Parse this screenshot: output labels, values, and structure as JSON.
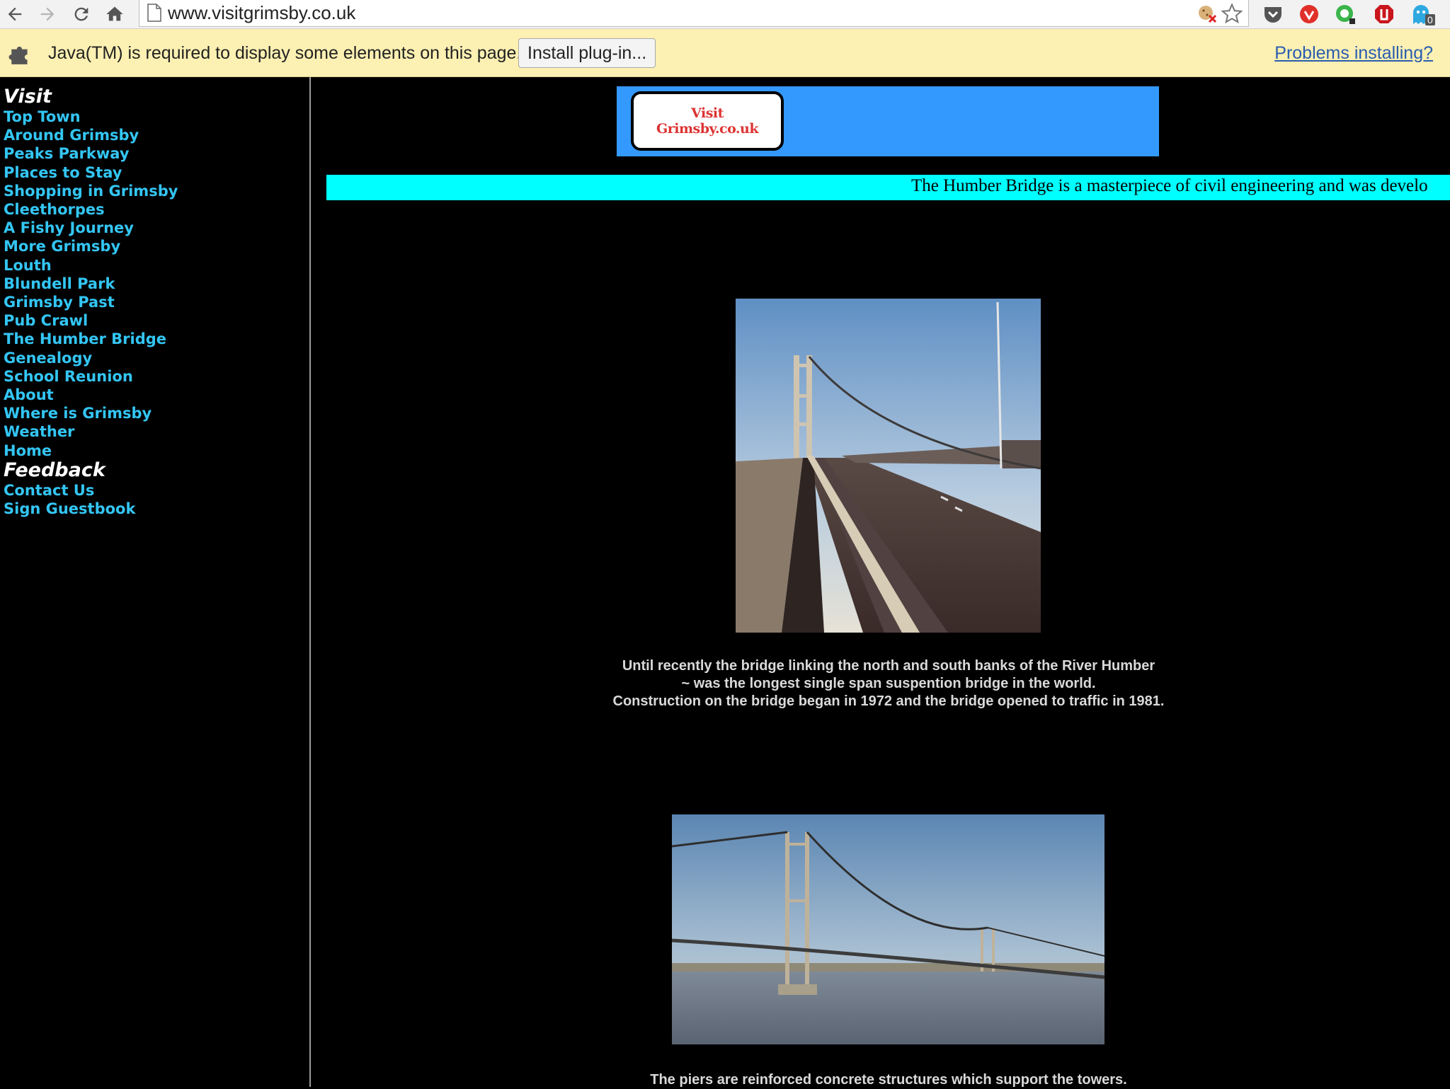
{
  "browser": {
    "url": "www.visitgrimsby.co.uk"
  },
  "infobar": {
    "message": "Java(TM) is required to display some elements on this page.",
    "install_button": "Install plug-in...",
    "problems_link": "Problems installing?"
  },
  "sidebar": {
    "visit_title": "Visit",
    "visit_links": [
      "Top Town",
      "Around Grimsby",
      "Peaks Parkway",
      "Places to Stay",
      "Shopping in Grimsby",
      "Cleethorpes",
      "A Fishy Journey",
      "More Grimsby",
      "Louth",
      "Blundell Park",
      "Grimsby Past",
      "Pub Crawl",
      "The Humber Bridge",
      "Genealogy",
      "School Reunion",
      "About",
      "Where is Grimsby",
      "Weather",
      "Home"
    ],
    "feedback_title": "Feedback",
    "feedback_links": [
      "Contact Us",
      "Sign Guestbook"
    ]
  },
  "banner": {
    "logo_line1": "Visit",
    "logo_line2": "Grimsby.co.uk"
  },
  "marquee": {
    "text": "The Humber Bridge is a masterpiece of civil engineering and was develo"
  },
  "captions": {
    "caption1_line1": "Until recently the bridge linking the north and south banks of the River Humber",
    "caption1_line2": "~ was the longest single span suspention bridge in the world.",
    "caption1_line3": "Construction on the bridge began in 1972 and the bridge opened to traffic in 1981.",
    "caption2": "The piers are reinforced concrete structures which support the towers."
  },
  "extensions": {
    "ext5_badge": "0"
  },
  "colors": {
    "link": "#33c6f4",
    "marquee_bg": "#00ffff",
    "banner_bg": "#3399ff",
    "infobar_bg": "#fcf0b2"
  }
}
